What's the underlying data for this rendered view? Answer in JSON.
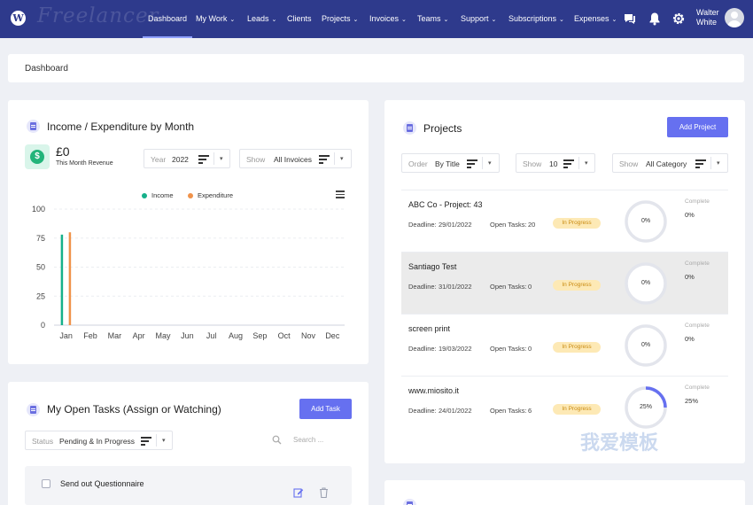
{
  "nav": {
    "brand": "Freelancer",
    "items": [
      {
        "label": "Dashboard",
        "active": true,
        "dropdown": false
      },
      {
        "label": "My Work",
        "dropdown": true
      },
      {
        "label": "Leads",
        "dropdown": true
      },
      {
        "label": "Clients",
        "dropdown": false
      },
      {
        "label": "Projects",
        "dropdown": true
      },
      {
        "label": "Invoices",
        "dropdown": true
      },
      {
        "label": "Teams",
        "dropdown": true
      },
      {
        "label": "Support",
        "dropdown": true
      },
      {
        "label": "Subscriptions",
        "dropdown": true
      },
      {
        "label": "Expenses",
        "dropdown": true
      }
    ],
    "caret": "⌄",
    "user_first": "Walter",
    "user_last": "White",
    "icons": [
      "chat-icon",
      "bell-icon",
      "gear-icon"
    ]
  },
  "breadcrumb": "Dashboard",
  "income": {
    "title": "Income / Expenditure by Month",
    "amount": "£0",
    "amount_label": "This Month Revenue",
    "currency_symbol": "$",
    "year_label": "Year",
    "year_value": "2022",
    "show_label": "Show",
    "show_value": "All Invoices",
    "caret": "▾"
  },
  "chart_data": {
    "type": "bar",
    "categories": [
      "Jan",
      "Feb",
      "Mar",
      "Apr",
      "May",
      "Jun",
      "Jul",
      "Aug",
      "Sep",
      "Oct",
      "Nov",
      "Dec"
    ],
    "series": [
      {
        "name": "Income",
        "color": "#16b08a",
        "values": [
          78,
          0,
          0,
          0,
          0,
          0,
          0,
          0,
          0,
          0,
          0,
          0
        ]
      },
      {
        "name": "Expenditure",
        "color": "#f0924a",
        "values": [
          80,
          0,
          0,
          0,
          0,
          0,
          0,
          0,
          0,
          0,
          0,
          0
        ]
      }
    ],
    "yticks": [
      "100",
      "75",
      "50",
      "25",
      "0"
    ],
    "ylim": [
      0,
      100
    ],
    "legend_position": "top-center",
    "grid": true
  },
  "projects": {
    "title": "Projects",
    "add_label": "Add Project",
    "order_label": "Order",
    "order_value": "By Title",
    "show_label": "Show",
    "show_value": "10",
    "category_label": "Show",
    "category_value": "All Category",
    "caret": "▾",
    "deadline_label": "Deadline:",
    "open_tasks_label": "Open Tasks:",
    "complete_label": "Complete",
    "items": [
      {
        "name": "ABC Co - Project: 43",
        "deadline": "29/01/2022",
        "open_tasks": "20",
        "status": "In Progress",
        "progress": 0,
        "progress_text": "0%",
        "highlight": false
      },
      {
        "name": "Santiago Test",
        "deadline": "31/01/2022",
        "open_tasks": "0",
        "status": "In Progress",
        "progress": 0,
        "progress_text": "0%",
        "highlight": true
      },
      {
        "name": "screen print",
        "deadline": "19/03/2022",
        "open_tasks": "0",
        "status": "In Progress",
        "progress": 0,
        "progress_text": "0%",
        "highlight": false
      },
      {
        "name": "www.miosito.it",
        "deadline": "24/01/2022",
        "open_tasks": "6",
        "status": "In Progress",
        "progress": 25,
        "progress_text": "25%",
        "highlight": false
      }
    ]
  },
  "tasks": {
    "title": "My Open Tasks (Assign or Watching)",
    "add_label": "Add Task",
    "status_label": "Status",
    "status_value": "Pending & In Progress",
    "caret": "▾",
    "search_placeholder": "Search ...",
    "first_task": "Send out Questionnaire"
  },
  "watermark": "我爱模板"
}
